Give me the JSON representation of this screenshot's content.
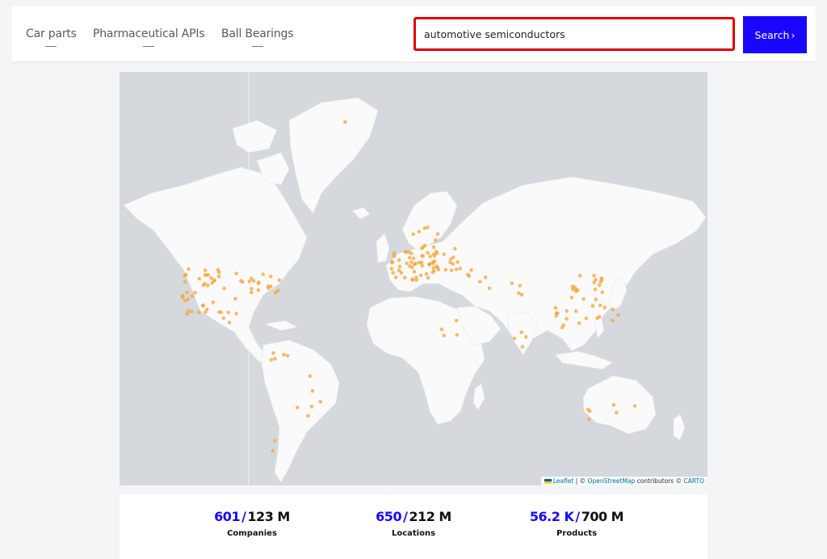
{
  "nav": {
    "tabs": [
      {
        "label": "Car parts"
      },
      {
        "label": "Pharmaceutical APIs"
      },
      {
        "label": "Ball Bearings"
      }
    ]
  },
  "search": {
    "value": "automotive semiconductors",
    "button_label": "Search",
    "button_icon": "chevron-right-icon"
  },
  "map": {
    "marker_color": "#f7a33a",
    "attribution": {
      "leaflet": "Leaflet",
      "separator": " | © ",
      "osm": "OpenStreetMap",
      "contributors": " contributors © ",
      "carto": "CARTO"
    }
  },
  "stats": [
    {
      "value": "601",
      "total": "123 M",
      "label": "Companies"
    },
    {
      "value": "650",
      "total": "212 M",
      "label": "Locations"
    },
    {
      "value": "56.2 K",
      "total": "700 M",
      "label": "Products"
    }
  ],
  "colors": {
    "accent": "#1a06ff",
    "highlight_border": "#e00000",
    "ocean": "#d5d9dd",
    "land": "#fafafa"
  }
}
